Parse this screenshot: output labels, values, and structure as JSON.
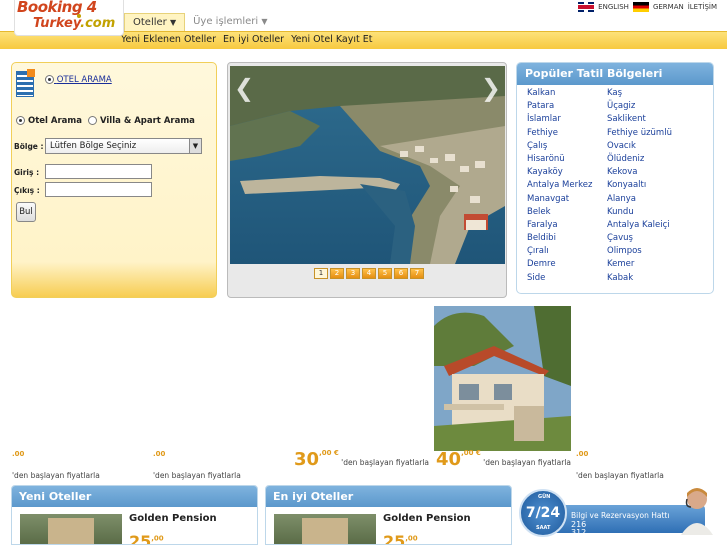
{
  "brand": {
    "logo_line1": "Booking 4",
    "logo_line2a": "Turkey",
    "logo_line2b": ".com"
  },
  "top_menu": {
    "items": [
      {
        "label": "Oteller",
        "active": true
      },
      {
        "label": "Üye işlemleri",
        "active": false
      }
    ]
  },
  "languages": {
    "english": "ENGLISH",
    "german": "GERMAN",
    "contact": "İLETİŞİM"
  },
  "sub_nav": [
    "Yeni Eklenen Oteller",
    "En iyi Oteller",
    "Yeni Otel Kayıt Et"
  ],
  "search": {
    "tab_label": "OTEL ARAMA",
    "type_otel": "Otel Arama",
    "type_villa": "Villa & Apart Arama",
    "region_label": "Bölge :",
    "region_value": "Lütfen Bölge Seçiniz",
    "checkin_label": "Giriş :",
    "checkout_label": "Çıkış :",
    "checkin_value": "",
    "checkout_value": "",
    "submit_label": "Bul"
  },
  "slider": {
    "pages": [
      "1",
      "2",
      "3",
      "4",
      "5",
      "6",
      "7"
    ],
    "active_page": "1",
    "prev_arrow": "❮",
    "next_arrow": "❯"
  },
  "popular": {
    "title": "Popüler Tatil Bölgeleri",
    "col1": [
      "Kalkan",
      "Patara",
      "İslamlar",
      "Fethiye",
      "Çalış",
      "Hisarönü",
      "Kayaköy",
      "Antalya Merkez",
      "Manavgat",
      "Belek",
      "Faralya",
      "Beldibi",
      "Çıralı",
      "Demre",
      "Side"
    ],
    "col2": [
      "Kaş",
      "Üçagiz",
      "Saklikent",
      "Fethiye üzümlü",
      "Ovacık",
      "Ölüdeniz",
      "Kekova",
      "Konyaaltı",
      "Alanya",
      "Kundu",
      "Antalya Kaleiçi",
      "Çavuş",
      "Olimpos",
      "Kemer",
      "Kabak"
    ]
  },
  "prices": [
    {
      "big": "",
      "sup": ".00",
      "text": "'den başlayan fiyatlarla"
    },
    {
      "big": "",
      "sup": ".00",
      "text": "'den başlayan fiyatlarla"
    },
    {
      "big": "30",
      "sup": ",00 €",
      "text": "'den başlayan fiyatlarla"
    },
    {
      "big": "40",
      "sup": ",00 €",
      "text": "'den başlayan fiyatlarla"
    },
    {
      "big": "",
      "sup": ".00",
      "text": "'den başlayan fiyatlarla"
    }
  ],
  "panels": {
    "new_hotels": {
      "title": "Yeni Oteller",
      "hotel": "Golden Pension",
      "price": "25",
      "price_sup": ",00"
    },
    "best_hotels": {
      "title": "En iyi Oteller",
      "hotel": "Golden Pension",
      "price": "25",
      "price_sup": ",00"
    }
  },
  "support": {
    "badge": "7/24",
    "badge_top": "GÜN",
    "badge_bottom": "SAAT",
    "text": "Bilgi ve Rezervasyon Hattı",
    "number1": "216",
    "number2": "312"
  },
  "colors": {
    "accent_yellow": "#f7c93f",
    "panel_blue": "#5b98cc",
    "link_blue": "#1a3f9a",
    "price_orange": "#e09a1a",
    "logo_red": "#d1451d"
  }
}
